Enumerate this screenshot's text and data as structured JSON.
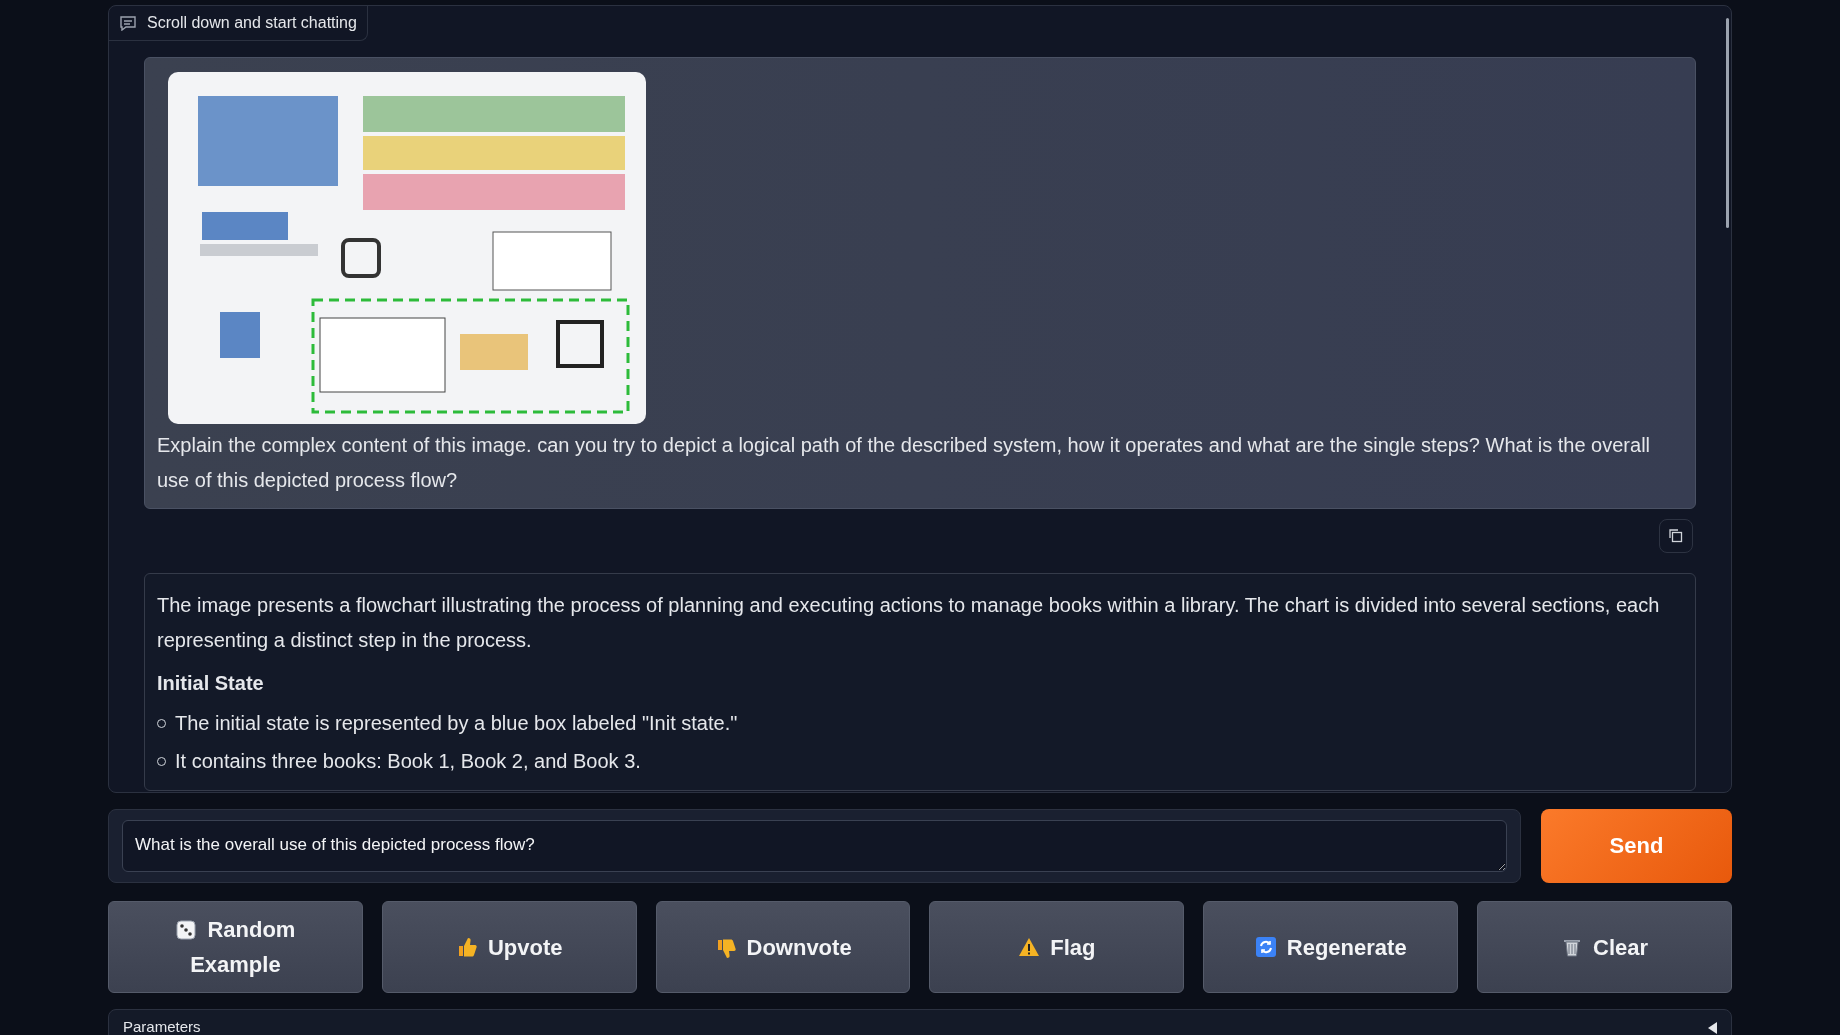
{
  "chat": {
    "label": "Scroll down and start chatting",
    "messages": [
      {
        "kind": "user",
        "text": "Explain the complex content of this image. can you try to depict a logical path of the described system, how it operates and what are the single steps? What is the overall use of this depicted process flow?"
      },
      {
        "kind": "bot",
        "blocks": [
          {
            "kind": "paragraph",
            "text": "The image presents a flowchart illustrating the process of planning and executing actions to manage books within a library. The chart is divided into several sections, each representing a distinct step in the process."
          },
          {
            "kind": "heading",
            "text": "Initial State"
          },
          {
            "kind": "bullet",
            "text": "The initial state is represented by a blue box labeled \"Init state.\""
          },
          {
            "kind": "bullet",
            "text": "It contains three books: Book 1, Book 2, and Book 3."
          }
        ]
      }
    ]
  },
  "input": {
    "value": "What is the overall use of this depicted process flow?"
  },
  "send_button": "Send",
  "buttons": [
    {
      "label": "Random Example"
    },
    {
      "label": "Upvote"
    },
    {
      "label": "Downvote"
    },
    {
      "label": "Flag"
    },
    {
      "label": "Regenerate"
    },
    {
      "label": "Clear"
    }
  ],
  "parameters": {
    "label": "Parameters",
    "expanded": false
  }
}
